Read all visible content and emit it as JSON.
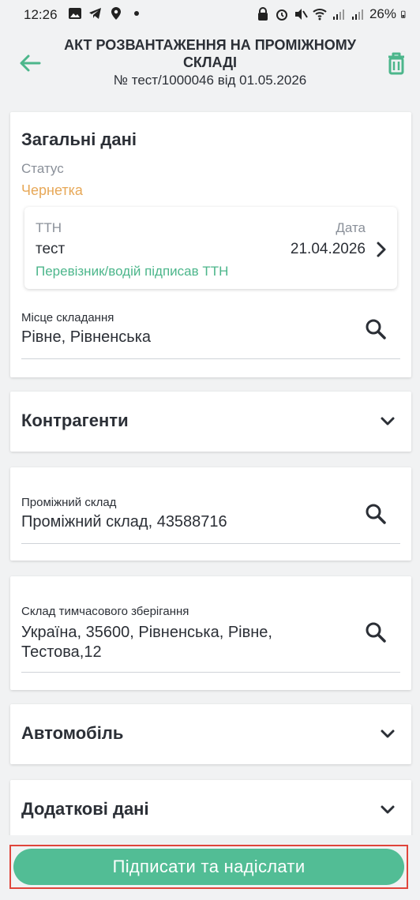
{
  "status_bar": {
    "time": "12:26",
    "battery": "26%"
  },
  "header": {
    "title": "АКТ РОЗВАНТАЖЕННЯ НА ПРОМІЖНОМУ СКЛАДІ",
    "subtitle": "№ тест/1000046 від 01.05.2026"
  },
  "general": {
    "heading": "Загальні дані",
    "status_label": "Статус",
    "status_value": "Чернетка",
    "ttn": {
      "label": "ТТН",
      "value": "тест",
      "date_label": "Дата",
      "date_value": "21.04.2026",
      "signed_text": "Перевізник/водій підписав ТТН"
    },
    "place_label": "Місце складання",
    "place_value": "Рівне, Рівненська"
  },
  "sections": {
    "contractors": "Контрагенти",
    "vehicle": "Автомобіль",
    "extra": "Додаткові дані"
  },
  "intermediate": {
    "label": "Проміжний склад",
    "value": "Проміжний склад, 43588716"
  },
  "temporary": {
    "label": "Склад тимчасового зберігання",
    "value": "Україна, 35600, Рівненська, Рівне, Тестова,12"
  },
  "actions": {
    "submit_label": "Підписати та надіслати"
  },
  "colors": {
    "accent": "#52bd95",
    "status_draft": "#e7a858",
    "signed": "#4cb68b",
    "highlight_frame": "#e0453b"
  }
}
